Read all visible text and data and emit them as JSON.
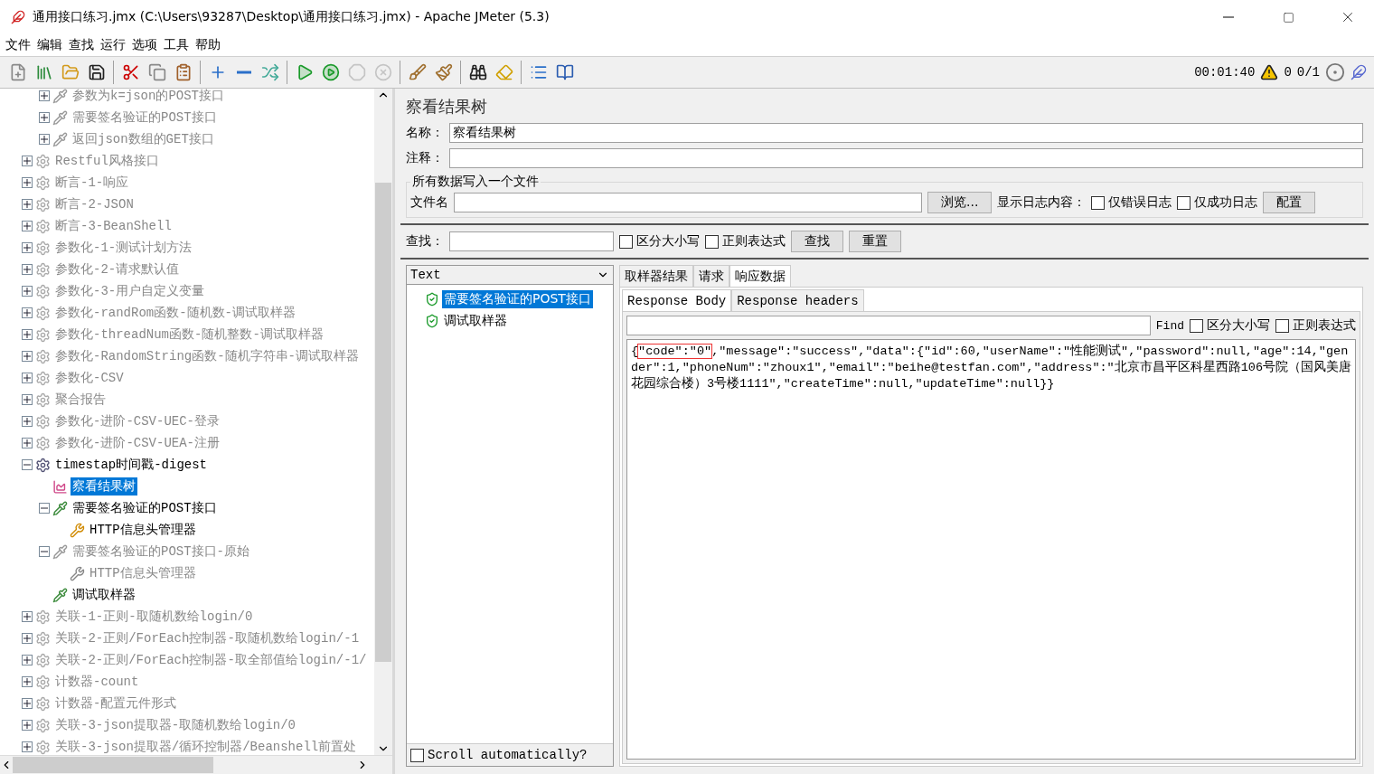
{
  "window": {
    "title": "通用接口练习.jmx (C:\\Users\\93287\\Desktop\\通用接口练习.jmx) - Apache JMeter (5.3)"
  },
  "menu": [
    "文件",
    "编辑",
    "查找",
    "运行",
    "选项",
    "工具",
    "帮助"
  ],
  "toolbar": [
    {
      "kind": "new"
    },
    {
      "kind": "templates"
    },
    {
      "kind": "open"
    },
    {
      "kind": "save"
    },
    {
      "kind": "sep"
    },
    {
      "kind": "cut"
    },
    {
      "kind": "copy"
    },
    {
      "kind": "paste"
    },
    {
      "kind": "sep"
    },
    {
      "kind": "expand"
    },
    {
      "kind": "collapse"
    },
    {
      "kind": "toggle"
    },
    {
      "kind": "sep"
    },
    {
      "kind": "start",
      "disabled": false
    },
    {
      "kind": "start_no_pause",
      "disabled": false
    },
    {
      "kind": "stop",
      "disabled": true
    },
    {
      "kind": "shutdown",
      "disabled": true
    },
    {
      "kind": "sep"
    },
    {
      "kind": "clear"
    },
    {
      "kind": "clear_all"
    },
    {
      "kind": "sep"
    },
    {
      "kind": "search"
    },
    {
      "kind": "reset_search"
    },
    {
      "kind": "sep"
    },
    {
      "kind": "functions"
    },
    {
      "kind": "help"
    }
  ],
  "status": {
    "elapsed": "00:01:40",
    "errors": "0",
    "threads": "0/1"
  },
  "tree": {
    "scrolled_children": [
      {
        "label": "参数为k=json的POST接口",
        "kind": "sampler",
        "disabled": true,
        "expanded": false,
        "selected": false
      },
      {
        "label": "需要签名验证的POST接口",
        "kind": "sampler",
        "disabled": true,
        "expanded": false,
        "selected": false
      },
      {
        "label": "返回json数组的GET接口",
        "kind": "sampler",
        "disabled": true,
        "expanded": false,
        "selected": false
      }
    ],
    "items": [
      {
        "label": "Restful风格接口",
        "kind": "thread_group",
        "disabled": true,
        "expanded": false,
        "selected": false
      },
      {
        "label": "断言-1-响应",
        "kind": "thread_group",
        "disabled": true,
        "expanded": false,
        "selected": false
      },
      {
        "label": "断言-2-JSON",
        "kind": "thread_group",
        "disabled": true,
        "expanded": false,
        "selected": false
      },
      {
        "label": "断言-3-BeanShell",
        "kind": "thread_group",
        "disabled": true,
        "expanded": false,
        "selected": false
      },
      {
        "label": "参数化-1-测试计划方法",
        "kind": "thread_group",
        "disabled": true,
        "expanded": false,
        "selected": false
      },
      {
        "label": "参数化-2-请求默认值",
        "kind": "thread_group",
        "disabled": true,
        "expanded": false,
        "selected": false
      },
      {
        "label": "参数化-3-用户自定义变量",
        "kind": "thread_group",
        "disabled": true,
        "expanded": false,
        "selected": false
      },
      {
        "label": "参数化-randRom函数-随机数-调试取样器",
        "kind": "thread_group",
        "disabled": true,
        "expanded": false,
        "selected": false
      },
      {
        "label": "参数化-threadNum函数-随机整数-调试取样器",
        "kind": "thread_group",
        "disabled": true,
        "expanded": false,
        "selected": false
      },
      {
        "label": "参数化-RandomString函数-随机字符串-调试取样器",
        "kind": "thread_group",
        "disabled": true,
        "expanded": false,
        "selected": false
      },
      {
        "label": "参数化-CSV",
        "kind": "thread_group",
        "disabled": true,
        "expanded": false,
        "selected": false
      },
      {
        "label": "聚合报告",
        "kind": "thread_group",
        "disabled": true,
        "expanded": false,
        "selected": false
      },
      {
        "label": "参数化-进阶-CSV-UEC-登录",
        "kind": "thread_group",
        "disabled": true,
        "expanded": false,
        "selected": false
      },
      {
        "label": "参数化-进阶-CSV-UEA-注册",
        "kind": "thread_group",
        "disabled": true,
        "expanded": false,
        "selected": false
      },
      {
        "label": "timestap时间戳-digest",
        "kind": "thread_group",
        "disabled": false,
        "expanded": true,
        "selected": false,
        "children": [
          {
            "label": "察看结果树",
            "kind": "listener",
            "disabled": false,
            "selected": true
          },
          {
            "label": "需要签名验证的POST接口",
            "kind": "sampler",
            "disabled": false,
            "expanded": true,
            "selected": false,
            "children": [
              {
                "label": "HTTP信息头管理器",
                "kind": "config",
                "disabled": false,
                "selected": false
              }
            ]
          },
          {
            "label": "需要签名验证的POST接口-原始",
            "kind": "sampler",
            "disabled": true,
            "expanded": true,
            "selected": false,
            "children": [
              {
                "label": "HTTP信息头管理器",
                "kind": "config",
                "disabled": true,
                "selected": false
              }
            ]
          },
          {
            "label": "调试取样器",
            "kind": "sampler",
            "disabled": false,
            "selected": false
          }
        ]
      },
      {
        "label": "关联-1-正则-取随机数给login/0",
        "kind": "thread_group",
        "disabled": true,
        "expanded": false,
        "selected": false
      },
      {
        "label": "关联-2-正则/ForEach控制器-取随机数给login/-1",
        "kind": "thread_group",
        "disabled": true,
        "expanded": false,
        "selected": false
      },
      {
        "label": "关联-2-正则/ForEach控制器-取全部值给login/-1/",
        "kind": "thread_group",
        "disabled": true,
        "expanded": false,
        "selected": false
      },
      {
        "label": "计数器-count",
        "kind": "thread_group",
        "disabled": true,
        "expanded": false,
        "selected": false
      },
      {
        "label": "计数器-配置元件形式",
        "kind": "thread_group",
        "disabled": true,
        "expanded": false,
        "selected": false
      },
      {
        "label": "关联-3-json提取器-取随机数给login/0",
        "kind": "thread_group",
        "disabled": true,
        "expanded": false,
        "selected": false
      },
      {
        "label": "关联-3-json提取器/循环控制器/Beanshell前置处",
        "kind": "thread_group",
        "disabled": true,
        "expanded": false,
        "selected": false
      }
    ]
  },
  "panel": {
    "title": "察看结果树",
    "name_label": "名称：",
    "name_value": "察看结果树",
    "comment_label": "注释：",
    "file_group": {
      "legend": "所有数据写入一个文件",
      "file_label": "文件名",
      "browse": "浏览...",
      "log_label": "显示日志内容：",
      "options": [
        {
          "label": "仅错误日志",
          "checked": false
        },
        {
          "label": "仅成功日志",
          "checked": false
        }
      ],
      "configure": "配置"
    },
    "search": {
      "label": "查找：",
      "options": [
        {
          "label": "区分大小写",
          "checked": false
        },
        {
          "label": "正则表达式",
          "checked": false
        }
      ],
      "find": "查找",
      "reset": "重置"
    },
    "renderer": "Text",
    "results": [
      {
        "label": "需要签名验证的POST接口",
        "success": true,
        "selected": true
      },
      {
        "label": "调试取样器",
        "success": true,
        "selected": false
      }
    ],
    "scroll_auto": {
      "label": "Scroll automatically?",
      "checked": false
    },
    "tabs": [
      {
        "label": "取样器结果",
        "selected": false
      },
      {
        "label": "请求",
        "selected": false
      },
      {
        "label": "响应数据",
        "selected": true
      }
    ],
    "subtabs": [
      {
        "label": "Response Body",
        "selected": true
      },
      {
        "label": "Response headers",
        "selected": false
      }
    ],
    "find": {
      "label": "Find",
      "options": [
        {
          "label": "区分大小写",
          "checked": false
        },
        {
          "label": "正则表达式",
          "checked": false
        }
      ]
    },
    "response": {
      "before": "{",
      "highlighted": "\"code\":\"0\"",
      "after": ",\"message\":\"success\",\"data\":{\"id\":60,\"userName\":\"性能测试\",\"password\":null,\"age\":14,\"gender\":1,\"phoneNum\":\"zhoux1\",\"email\":\"beihe@testfan.com\",\"address\":\"北京市昌平区科星西路106号院（国风美唐花园综合楼）3号楼1111\",\"createTime\":null,\"updateTime\":null}}"
    }
  }
}
